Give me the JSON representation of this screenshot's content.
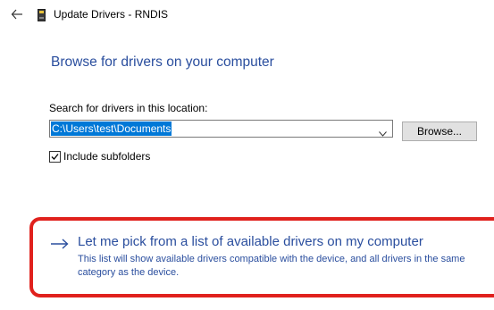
{
  "window": {
    "title": "Update Drivers - RNDIS"
  },
  "page": {
    "heading": "Browse for drivers on your computer"
  },
  "search": {
    "label": "Search for drivers in this location:",
    "path_value": "C:\\Users\\test\\Documents",
    "browse_label": "Browse..."
  },
  "subfolders": {
    "label": "Include subfolders",
    "checked": true
  },
  "pick_option": {
    "title": "Let me pick from a list of available drivers on my computer",
    "description": "This list will show available drivers compatible with the device, and all drivers in the same category as the device."
  },
  "colors": {
    "link_blue": "#2a4e9e",
    "selection_blue": "#0078d7",
    "highlight_red": "#e0211d"
  },
  "icons": {
    "back": "back-arrow-icon",
    "device": "device-icon",
    "dropdown": "chevron-down-icon",
    "check": "checkmark-icon",
    "option_arrow": "right-arrow-icon"
  }
}
